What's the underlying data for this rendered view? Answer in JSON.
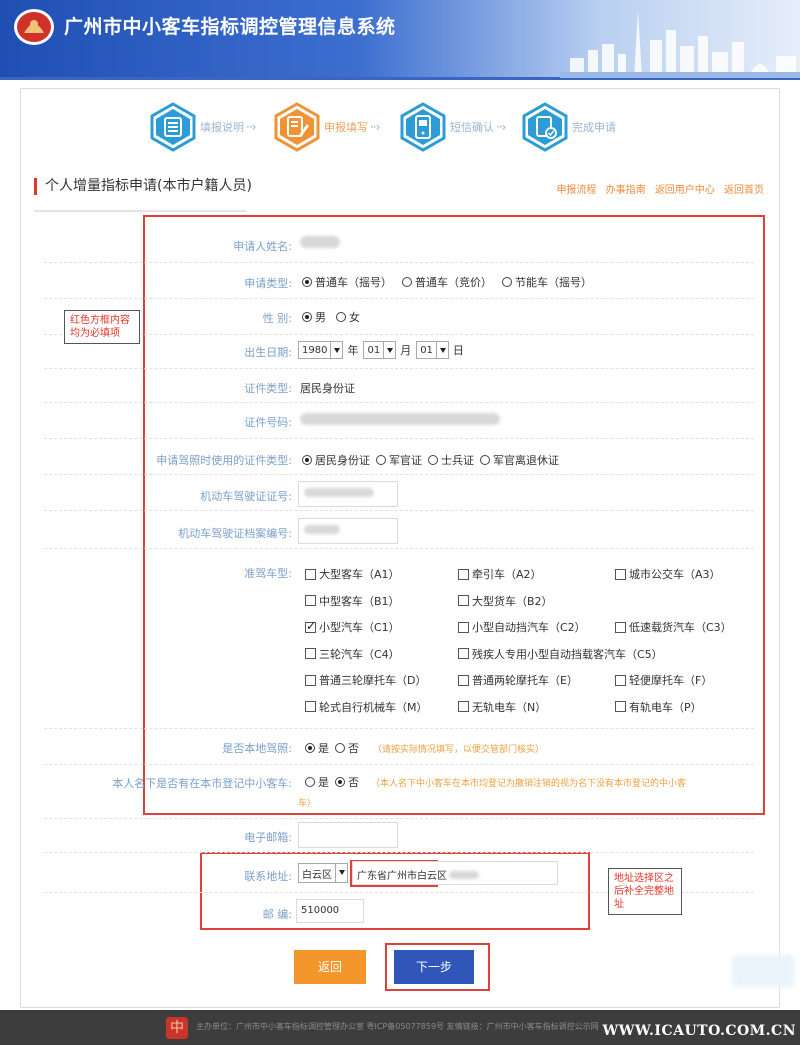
{
  "header": {
    "title": "广州市中小客车指标调控管理信息系统"
  },
  "steps": [
    {
      "label": "填报说明",
      "icon": "list-icon",
      "active": false
    },
    {
      "label": "申报填写",
      "icon": "edit-icon",
      "active": true
    },
    {
      "label": "短信确认",
      "icon": "phone-icon",
      "active": false
    },
    {
      "label": "完成申请",
      "icon": "check-doc-icon",
      "active": false
    }
  ],
  "section": {
    "title": "个人增量指标申请(本市户籍人员)",
    "links": [
      "申报流程",
      "办事指南",
      "返回用户中心",
      "返回首页"
    ]
  },
  "form": {
    "name_label": "申请人姓名:",
    "type_label": "申请类型:",
    "type_options": [
      "普通车（摇号）",
      "普通车（竞价）",
      "节能车（摇号）"
    ],
    "gender_label": "性    别:",
    "gender_options": [
      "男",
      "女"
    ],
    "birth_label": "出生日期:",
    "birth_year": "1980",
    "birth_year_unit": "年",
    "birth_month": "01",
    "birth_month_unit": "月",
    "birth_day": "01",
    "birth_day_unit": "日",
    "idtype_label": "证件类型:",
    "idtype_value": "居民身份证",
    "idno_label": "证件号码:",
    "license_idtype_label": "申请驾照时使用的证件类型:",
    "license_idtype_options": [
      "居民身份证",
      "军官证",
      "士兵证",
      "军官离退休证"
    ],
    "license_no_label": "机动车驾驶证证号:",
    "license_file_label": "机动车驾驶证档案编号:",
    "vehicle_class_label": "准驾车型:",
    "vehicle_classes": [
      [
        "大型客车（A1）",
        "牵引车（A2）",
        "城市公交车（A3）"
      ],
      [
        "中型客车（B1）",
        "大型货车（B2）",
        ""
      ],
      [
        "小型汽车（C1）",
        "小型自动挡汽车（C2）",
        "低速载货汽车（C3）"
      ],
      [
        "三轮汽车（C4）",
        "残疾人专用小型自动挡载客汽车（C5）",
        ""
      ],
      [
        "普通三轮摩托车（D）",
        "普通两轮摩托车（E）",
        "轻便摩托车（F）"
      ],
      [
        "轮式自行机械车（M）",
        "无轨电车（N）",
        "有轨电车（P）"
      ]
    ],
    "local_license_label": "是否本地驾照:",
    "local_license_options": [
      "是",
      "否"
    ],
    "local_license_note": "（请按实际情况填写，以便交管部门核实）",
    "owns_car_label": "本人名下是否有在本市登记中小客车:",
    "owns_car_options": [
      "是",
      "否"
    ],
    "owns_car_note": "（本人名下中小客车在本市均登记为撤销注销的视为名下没有本市登记的中小客",
    "owns_car_note_cont": "车）",
    "email_label": "电子邮箱:",
    "address_label": "联系地址:",
    "address_district": "白云区",
    "address_value": "广东省广州市白云区",
    "postcode_label": "邮    编:",
    "postcode_value": "510000"
  },
  "annotations": {
    "required_note": "红色方框内容均为必填项",
    "address_note": "地址选择区之后补全完整地址"
  },
  "buttons": {
    "back": "返回",
    "next": "下一步"
  },
  "footer": {
    "text": "主办单位：广州市中小客车指标调控管理办公室    粤ICP备05077859号    友情链接：广州市中小客车指标调控公示网",
    "logo_glyph": "中"
  },
  "watermark": "WWW.ICAUTO.COM.CN",
  "colors": {
    "accent_red": "#e0403a",
    "header_blue": "#1f4fb3",
    "label_blue": "#7a9fcc",
    "orange": "#f3962b"
  }
}
